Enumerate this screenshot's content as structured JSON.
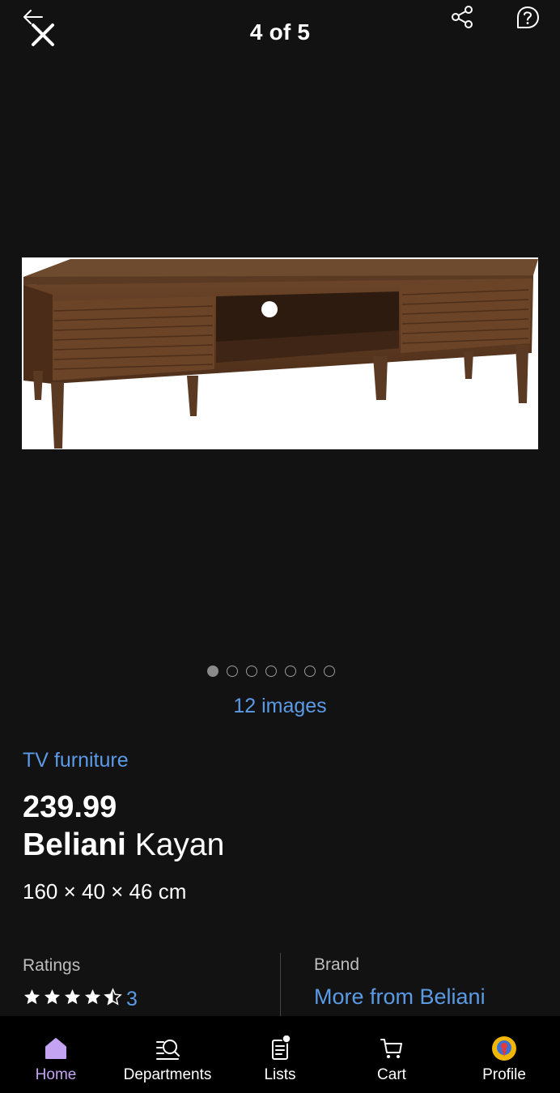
{
  "header": {
    "counter": "4 of 5"
  },
  "icons": {
    "back": "back-arrow-icon",
    "close": "close-icon",
    "share": "share-icon",
    "help": "help-icon"
  },
  "gallery": {
    "dots_total": 7,
    "active_dot": 1,
    "images_link": "12 images"
  },
  "product": {
    "category": "TV furniture",
    "price": "239.99",
    "brand": "Beliani",
    "name": "Kayan",
    "dimensions": "160 × 40 × 46 cm"
  },
  "ratings": {
    "label": "Ratings",
    "value": 4.5,
    "max": 5,
    "count": "3"
  },
  "brand_section": {
    "label": "Brand",
    "link": "More from Beliani"
  },
  "nav": {
    "items": [
      {
        "label": "Home",
        "icon": "home-icon",
        "active": true
      },
      {
        "label": "Departments",
        "icon": "departments-icon",
        "active": false
      },
      {
        "label": "Lists",
        "icon": "lists-icon",
        "active": false
      },
      {
        "label": "Cart",
        "icon": "cart-icon",
        "active": false
      },
      {
        "label": "Profile",
        "icon": "profile-icon",
        "active": false
      }
    ]
  },
  "colors": {
    "background": "#121212",
    "link": "#5b9be6",
    "nav_active": "#c4a4f2",
    "nav_bar": "#000000"
  }
}
